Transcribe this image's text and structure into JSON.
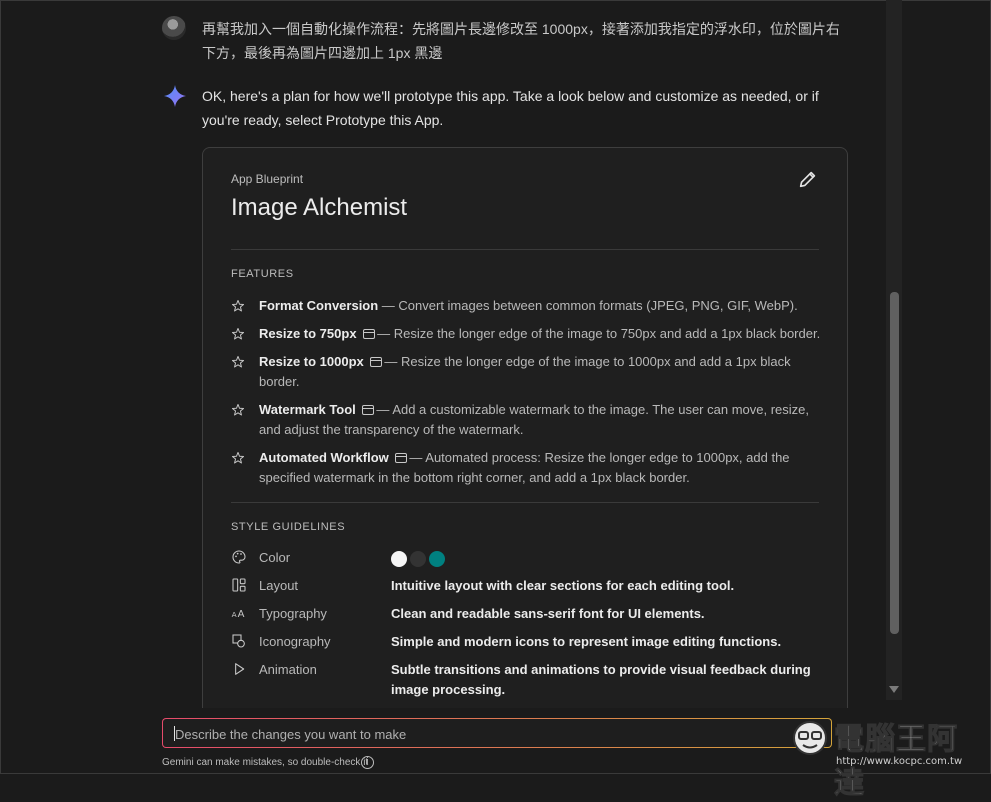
{
  "user_message": "再幫我加入一個自動化操作流程：先將圖片長邊修改至 1000px，接著添加我指定的浮水印，位於圖片右下方，最後再為圖片四邊加上 1px 黑邊",
  "model_message": "OK, here's a plan for how we'll prototype this app. Take a look below and customize as needed, or if you're ready, select Prototype this App.",
  "blueprint": {
    "label": "App Blueprint",
    "title": "Image Alchemist",
    "features_heading": "FEATURES",
    "features": [
      {
        "name": "Format Conversion",
        "has_window_icon": false,
        "desc": " — Convert images between common formats (JPEG, PNG, GIF, WebP)."
      },
      {
        "name": "Resize to 750px",
        "has_window_icon": true,
        "desc": "— Resize the longer edge of the image to 750px and add a 1px black border."
      },
      {
        "name": "Resize to 1000px",
        "has_window_icon": true,
        "desc": "— Resize the longer edge of the image to 1000px and add a 1px black border."
      },
      {
        "name": "Watermark Tool",
        "has_window_icon": true,
        "desc": "— Add a customizable watermark to the image. The user can move, resize, and adjust the transparency of the watermark."
      },
      {
        "name": "Automated Workflow",
        "has_window_icon": true,
        "desc": "— Automated process: Resize the longer edge to 1000px, add the specified watermark in the bottom right corner, and add a 1px black border."
      }
    ],
    "style_heading": "STYLE GUIDELINES",
    "style": [
      {
        "icon": "palette-icon",
        "name": "Color",
        "value": "",
        "swatches": [
          "#f5f5f5",
          "#333333",
          "#008080"
        ]
      },
      {
        "icon": "layout-icon",
        "name": "Layout",
        "value": "Intuitive layout with clear sections for each editing tool."
      },
      {
        "icon": "typography-icon",
        "name": "Typography",
        "value": "Clean and readable sans-serif font for UI elements."
      },
      {
        "icon": "shapes-icon",
        "name": "Iconography",
        "value": "Simple and modern icons to represent image editing functions."
      },
      {
        "icon": "play-icon",
        "name": "Animation",
        "value": "Subtle transitions and animations to provide visual feedback during image processing."
      }
    ]
  },
  "composer": {
    "placeholder": "Describe the changes you want to make"
  },
  "disclaimer": "Gemini can make mistakes, so double-check it",
  "watermark": {
    "title": "電腦王阿達",
    "url": "http://www.kocpc.com.tw"
  },
  "colors": {
    "background": "#1b1b1b",
    "card": "#1f1f1f",
    "input_gradient_start": "#e64b6b",
    "input_gradient_end": "#d4a43a"
  }
}
